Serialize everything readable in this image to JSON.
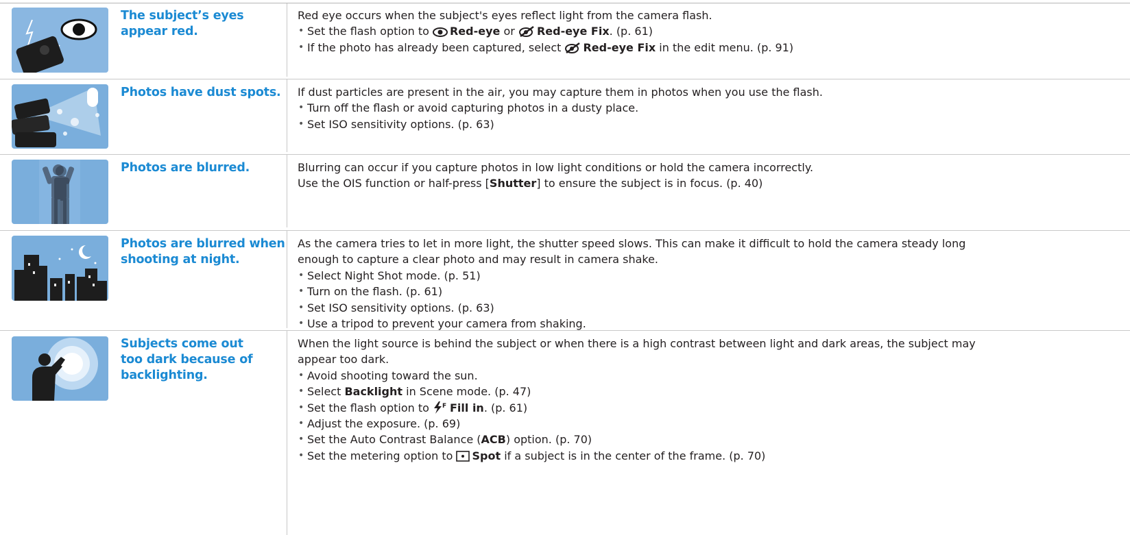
{
  "rows": [
    {
      "issue": "The subject’s eyes appear red.",
      "intro": "Red eye occurs when the subject's eyes reflect light from the camera flash.",
      "b1": {
        "pre": "Set the flash option to ",
        "kw1": "Red-eye",
        "mid": " or ",
        "kw2": "Red-eye Fix",
        "post": ". (p. 61)"
      },
      "b2": {
        "pre": "If the photo has already been captured, select ",
        "kw": "Red-eye Fix",
        "post": " in the edit menu. (p. 91)"
      }
    },
    {
      "issue": "Photos have dust spots.",
      "intro": "If dust particles are present in the air, you may capture them in photos when you use the flash.",
      "bullets": [
        "Turn off the flash or avoid capturing photos in a dusty place.",
        "Set ISO sensitivity options. (p. 63)"
      ]
    },
    {
      "issue": "Photos are blurred.",
      "line1": "Blurring can occur if you capture photos in low light conditions or hold the camera incorrectly.",
      "line2": {
        "pre": "Use the OIS function or half-press [",
        "kw": "Shutter",
        "post": "] to ensure the subject is in focus. (p. 40)"
      }
    },
    {
      "issue": "Photos are blurred when shooting at night.",
      "intro1": "As the camera tries to let in more light, the shutter speed slows. This can make it difficult to hold the camera steady long",
      "intro2": "enough to capture a clear photo and may result in camera shake.",
      "bullets": [
        "Select Night Shot mode. (p. 51)",
        "Turn on the flash. (p. 61)",
        "Set ISO sensitivity options. (p. 63)",
        "Use a tripod to prevent your camera from shaking."
      ]
    },
    {
      "issue": "Subjects come out too dark because of backlighting.",
      "intro1": "When the light source is behind the subject or when there is a high contrast between light and dark areas, the subject may",
      "intro2": "appear too dark.",
      "b1": "Avoid shooting toward the sun.",
      "b2": {
        "pre": "Select ",
        "kw": "Backlight",
        "post": " in Scene mode. (p. 47)"
      },
      "b3": {
        "pre": "Set the flash option to ",
        "kw": "Fill in",
        "post": ". (p. 61)"
      },
      "b4": "Adjust the exposure. (p. 69)",
      "b5": {
        "pre": "Set the Auto Contrast Balance (",
        "kw": "ACB",
        "post": ") option. (p. 70)"
      },
      "b6": {
        "pre": "Set the metering option to ",
        "kw": "Spot",
        "post": " if a subject is in the center of the frame. (p. 70)"
      }
    }
  ],
  "icons": {
    "row1": "red-eye-camera-illustration",
    "row2": "dust-spots-illustration",
    "row3": "blurred-person-illustration",
    "row4": "night-city-illustration",
    "row5": "backlight-person-illustration"
  },
  "colors": {
    "accent": "#1b8ad3",
    "thumb_bg": "#7aaedc",
    "text": "#231f20"
  }
}
